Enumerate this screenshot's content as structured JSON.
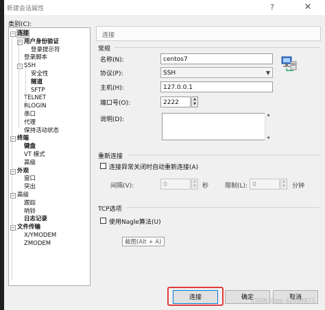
{
  "window": {
    "title": "新建会话属性",
    "help": "?",
    "close": "✕"
  },
  "category_label": "类别(C):",
  "tree": [
    {
      "label": "连接",
      "bold": true
    },
    {
      "label": "用户身份验证",
      "bold": true
    },
    {
      "label": "登录提示符",
      "bold": false
    },
    {
      "label": "登录脚本",
      "bold": false
    },
    {
      "label": "SSH",
      "bold": false
    },
    {
      "label": "安全性",
      "bold": false
    },
    {
      "label": "隧道",
      "bold": true
    },
    {
      "label": "SFTP",
      "bold": false
    },
    {
      "label": "TELNET",
      "bold": false
    },
    {
      "label": "RLOGIN",
      "bold": false
    },
    {
      "label": "串口",
      "bold": false
    },
    {
      "label": "代理",
      "bold": false
    },
    {
      "label": "保持活动状态",
      "bold": false
    },
    {
      "label": "终端",
      "bold": true
    },
    {
      "label": "键盘",
      "bold": true
    },
    {
      "label": "VT 模式",
      "bold": false
    },
    {
      "label": "高级",
      "bold": false
    },
    {
      "label": "外观",
      "bold": true
    },
    {
      "label": "窗口",
      "bold": false
    },
    {
      "label": "突出",
      "bold": false
    },
    {
      "label": "高级",
      "bold": false
    },
    {
      "label": "跟踪",
      "bold": false
    },
    {
      "label": "响铃",
      "bold": false
    },
    {
      "label": "日志记录",
      "bold": true
    },
    {
      "label": "文件传输",
      "bold": true
    },
    {
      "label": "X/YMODEM",
      "bold": false
    },
    {
      "label": "ZMODEM",
      "bold": false
    }
  ],
  "panel": {
    "heading": "连接",
    "general": {
      "title": "常规",
      "name_label": "名称(N):",
      "name_value": "centos7",
      "protocol_label": "协议(P):",
      "protocol_value": "SSH",
      "host_label": "主机(H):",
      "host_value": "127.0.0.1",
      "port_label": "端口号(O):",
      "port_value": "2222",
      "desc_label": "说明(D):",
      "desc_value": ""
    },
    "reconnect": {
      "title": "重新连接",
      "checkbox_label": "连接异常关闭时自动重新连接(A)",
      "checked": false,
      "interval_label": "间隔(V):",
      "interval_value": "0",
      "interval_unit": "秒",
      "limit_label": "限制(L):",
      "limit_value": "0",
      "limit_unit": "分钟"
    },
    "tcp": {
      "title": "TCP选项",
      "nagle_label": "使用Nagle算法(U)",
      "checked": false
    }
  },
  "tooltip": "截图(Alt + A)",
  "buttons": {
    "connect": "连接",
    "ok": "确定",
    "cancel": "取消"
  },
  "watermark": "CSDN @qq_42694871",
  "colors": {
    "highlight": "#e23b3b",
    "focus_border": "#0078d7"
  },
  "icons": {
    "session": "network-computer-icon"
  }
}
